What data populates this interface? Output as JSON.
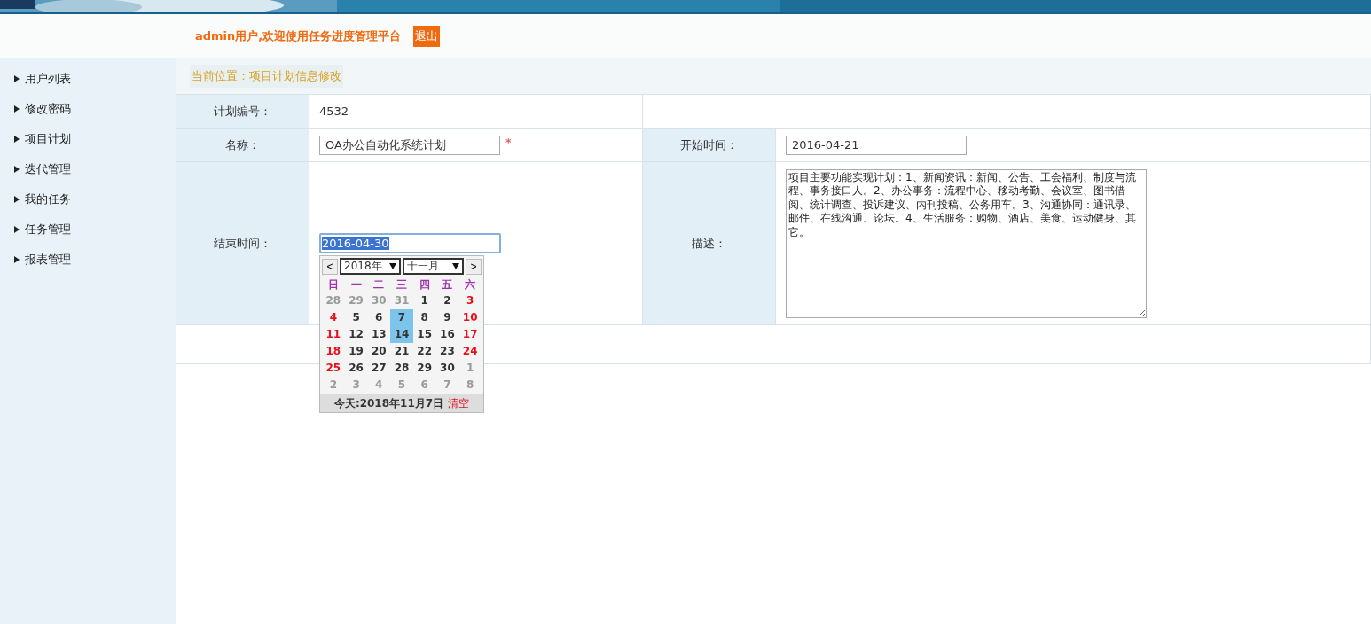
{
  "header": {
    "welcome": "admin用户,欢迎使用任务进度管理平台",
    "logout": "退出"
  },
  "sidebar": {
    "items": [
      {
        "label": "用户列表"
      },
      {
        "label": "修改密码"
      },
      {
        "label": "项目计划"
      },
      {
        "label": "迭代管理"
      },
      {
        "label": "我的任务"
      },
      {
        "label": "任务管理"
      },
      {
        "label": "报表管理"
      }
    ]
  },
  "breadcrumb": "当前位置：项目计划信息修改",
  "form": {
    "plan_no": {
      "label": "计划编号：",
      "value": "4532"
    },
    "name": {
      "label": "名称：",
      "value": "OA办公自动化系统计划",
      "required": "*"
    },
    "start": {
      "label": "开始时间：",
      "value": "2016-04-21"
    },
    "end": {
      "label": "结束时间：",
      "value": "2016-04-30"
    },
    "description": {
      "label": "描述：",
      "value": "项目主要功能实现计划：1、新闻资讯：新闻、公告、工会福利、制度与流程、事务接口人。2、办公事务：流程中心、移动考勤、会议室、图书借阅、统计调查、投诉建议、内刊投稿、公务用车。3、沟通协同：通讯录、邮件、在线沟通、论坛。4、生活服务：购物、酒店、美食、运动健身、其它。"
    }
  },
  "date_picker": {
    "prev": "<",
    "next": ">",
    "year": "2018年",
    "month": "十一月",
    "weekdays": [
      "日",
      "一",
      "二",
      "三",
      "四",
      "五",
      "六"
    ],
    "weeks": [
      [
        {
          "day": "28",
          "kind": "other",
          "highlighted": false
        },
        {
          "day": "29",
          "kind": "other",
          "highlighted": false
        },
        {
          "day": "30",
          "kind": "other",
          "highlighted": false
        },
        {
          "day": "31",
          "kind": "other",
          "highlighted": false
        },
        {
          "day": "1",
          "kind": "normal",
          "highlighted": false
        },
        {
          "day": "2",
          "kind": "normal",
          "highlighted": false
        },
        {
          "day": "3",
          "kind": "weekend",
          "highlighted": false
        }
      ],
      [
        {
          "day": "4",
          "kind": "weekend",
          "highlighted": false
        },
        {
          "day": "5",
          "kind": "normal",
          "highlighted": false
        },
        {
          "day": "6",
          "kind": "normal",
          "highlighted": false
        },
        {
          "day": "7",
          "kind": "normal",
          "highlighted": true
        },
        {
          "day": "8",
          "kind": "normal",
          "highlighted": false
        },
        {
          "day": "9",
          "kind": "normal",
          "highlighted": false
        },
        {
          "day": "10",
          "kind": "weekend",
          "highlighted": false
        }
      ],
      [
        {
          "day": "11",
          "kind": "weekend",
          "highlighted": false
        },
        {
          "day": "12",
          "kind": "normal",
          "highlighted": false
        },
        {
          "day": "13",
          "kind": "normal",
          "highlighted": false
        },
        {
          "day": "14",
          "kind": "normal",
          "highlighted": true
        },
        {
          "day": "15",
          "kind": "normal",
          "highlighted": false
        },
        {
          "day": "16",
          "kind": "normal",
          "highlighted": false
        },
        {
          "day": "17",
          "kind": "weekend",
          "highlighted": false
        }
      ],
      [
        {
          "day": "18",
          "kind": "weekend",
          "highlighted": false
        },
        {
          "day": "19",
          "kind": "normal",
          "highlighted": false
        },
        {
          "day": "20",
          "kind": "normal",
          "highlighted": false
        },
        {
          "day": "21",
          "kind": "normal",
          "highlighted": false
        },
        {
          "day": "22",
          "kind": "normal",
          "highlighted": false
        },
        {
          "day": "23",
          "kind": "normal",
          "highlighted": false
        },
        {
          "day": "24",
          "kind": "weekend",
          "highlighted": false
        }
      ],
      [
        {
          "day": "25",
          "kind": "weekend",
          "highlighted": false
        },
        {
          "day": "26",
          "kind": "normal",
          "highlighted": false
        },
        {
          "day": "27",
          "kind": "normal",
          "highlighted": false
        },
        {
          "day": "28",
          "kind": "normal",
          "highlighted": false
        },
        {
          "day": "29",
          "kind": "normal",
          "highlighted": false
        },
        {
          "day": "30",
          "kind": "normal",
          "highlighted": false
        },
        {
          "day": "1",
          "kind": "other",
          "highlighted": false
        }
      ],
      [
        {
          "day": "2",
          "kind": "other",
          "highlighted": false
        },
        {
          "day": "3",
          "kind": "other",
          "highlighted": false
        },
        {
          "day": "4",
          "kind": "other",
          "highlighted": false
        },
        {
          "day": "5",
          "kind": "other",
          "highlighted": false
        },
        {
          "day": "6",
          "kind": "other",
          "highlighted": false
        },
        {
          "day": "7",
          "kind": "other",
          "highlighted": false
        },
        {
          "day": "8",
          "kind": "other",
          "highlighted": false
        }
      ]
    ],
    "today": "今天:2018年11月7日",
    "clear": "清空"
  }
}
